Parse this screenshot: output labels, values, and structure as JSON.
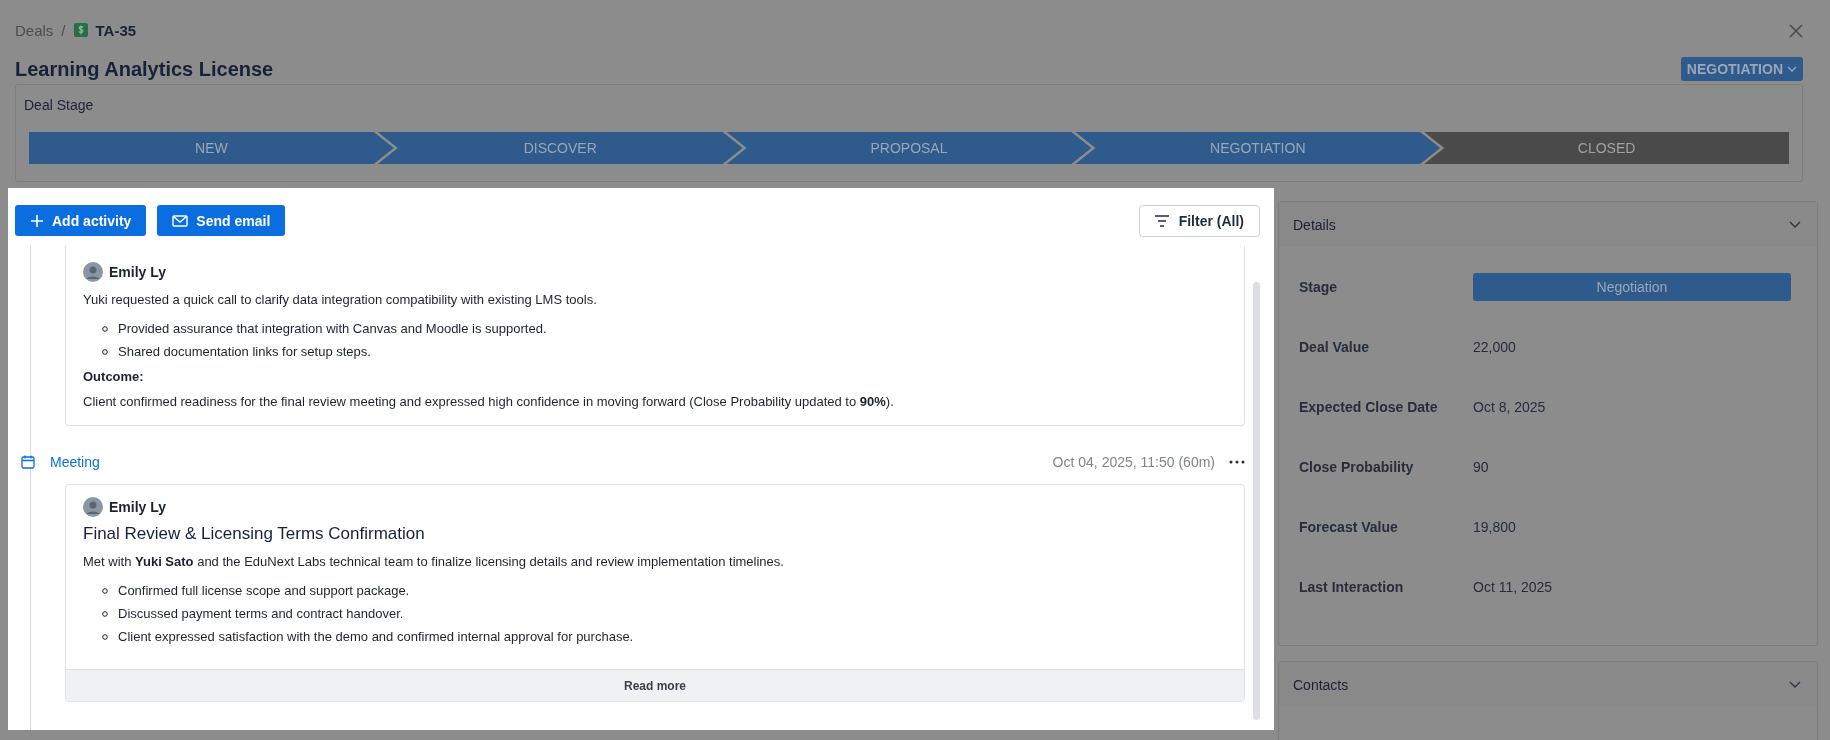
{
  "breadcrumb": {
    "parent": "Deals",
    "separator": "/",
    "current": "TA-35"
  },
  "title": "Learning Analytics License",
  "stage_button": {
    "label": "NEGOTIATION"
  },
  "deal_stage": {
    "label": "Deal Stage",
    "stages": [
      {
        "label": "NEW",
        "reached": true
      },
      {
        "label": "DISCOVER",
        "reached": true
      },
      {
        "label": "PROPOSAL",
        "reached": true
      },
      {
        "label": "NEGOTIATION",
        "reached": true
      },
      {
        "label": "CLOSED",
        "reached": false
      }
    ]
  },
  "toolbar": {
    "add_activity": "Add activity",
    "send_email": "Send email",
    "filter": "Filter (All)"
  },
  "activities": [
    {
      "kind": "note",
      "author": "Emily Ly",
      "intro": "Yuki requested a quick call to clarify data integration compatibility with existing LMS tools.",
      "bullets": [
        "Provided assurance that integration with Canvas and Moodle is supported.",
        "Shared documentation links for setup steps."
      ],
      "outcome_label": "Outcome:",
      "outcome": "Client confirmed readiness for the final review meeting and expressed high confidence in moving forward (Close Probability updated to **90%**)."
    },
    {
      "kind": "meeting",
      "type_label": "Meeting",
      "time": "Oct 04, 2025, 11:50 (60m)",
      "author": "Emily Ly",
      "heading": "Final Review & Licensing Terms Confirmation",
      "intro": "Met with **Yuki Sato** and the EduNext Labs technical team to finalize licensing details and review implementation timelines.",
      "bullets": [
        "Confirmed full license scope and support package.",
        "Discussed payment terms and contract handover.",
        "Client expressed satisfaction with the demo and confirmed internal approval for purchase."
      ],
      "read_more": "Read more"
    }
  ],
  "details": {
    "title": "Details",
    "fields": [
      {
        "kind": "pill",
        "label": "Stage",
        "value": "Negotiation"
      },
      {
        "kind": "text",
        "label": "Deal Value",
        "value": "22,000"
      },
      {
        "kind": "text",
        "label": "Expected Close Date",
        "value": "Oct 8, 2025"
      },
      {
        "kind": "text",
        "label": "Close Probability",
        "value": "90"
      },
      {
        "kind": "text",
        "label": "Forecast Value",
        "value": "19,800"
      },
      {
        "kind": "text",
        "label": "Last Interaction",
        "value": "Oct 11, 2025"
      }
    ]
  },
  "contacts": {
    "title": "Contacts"
  }
}
